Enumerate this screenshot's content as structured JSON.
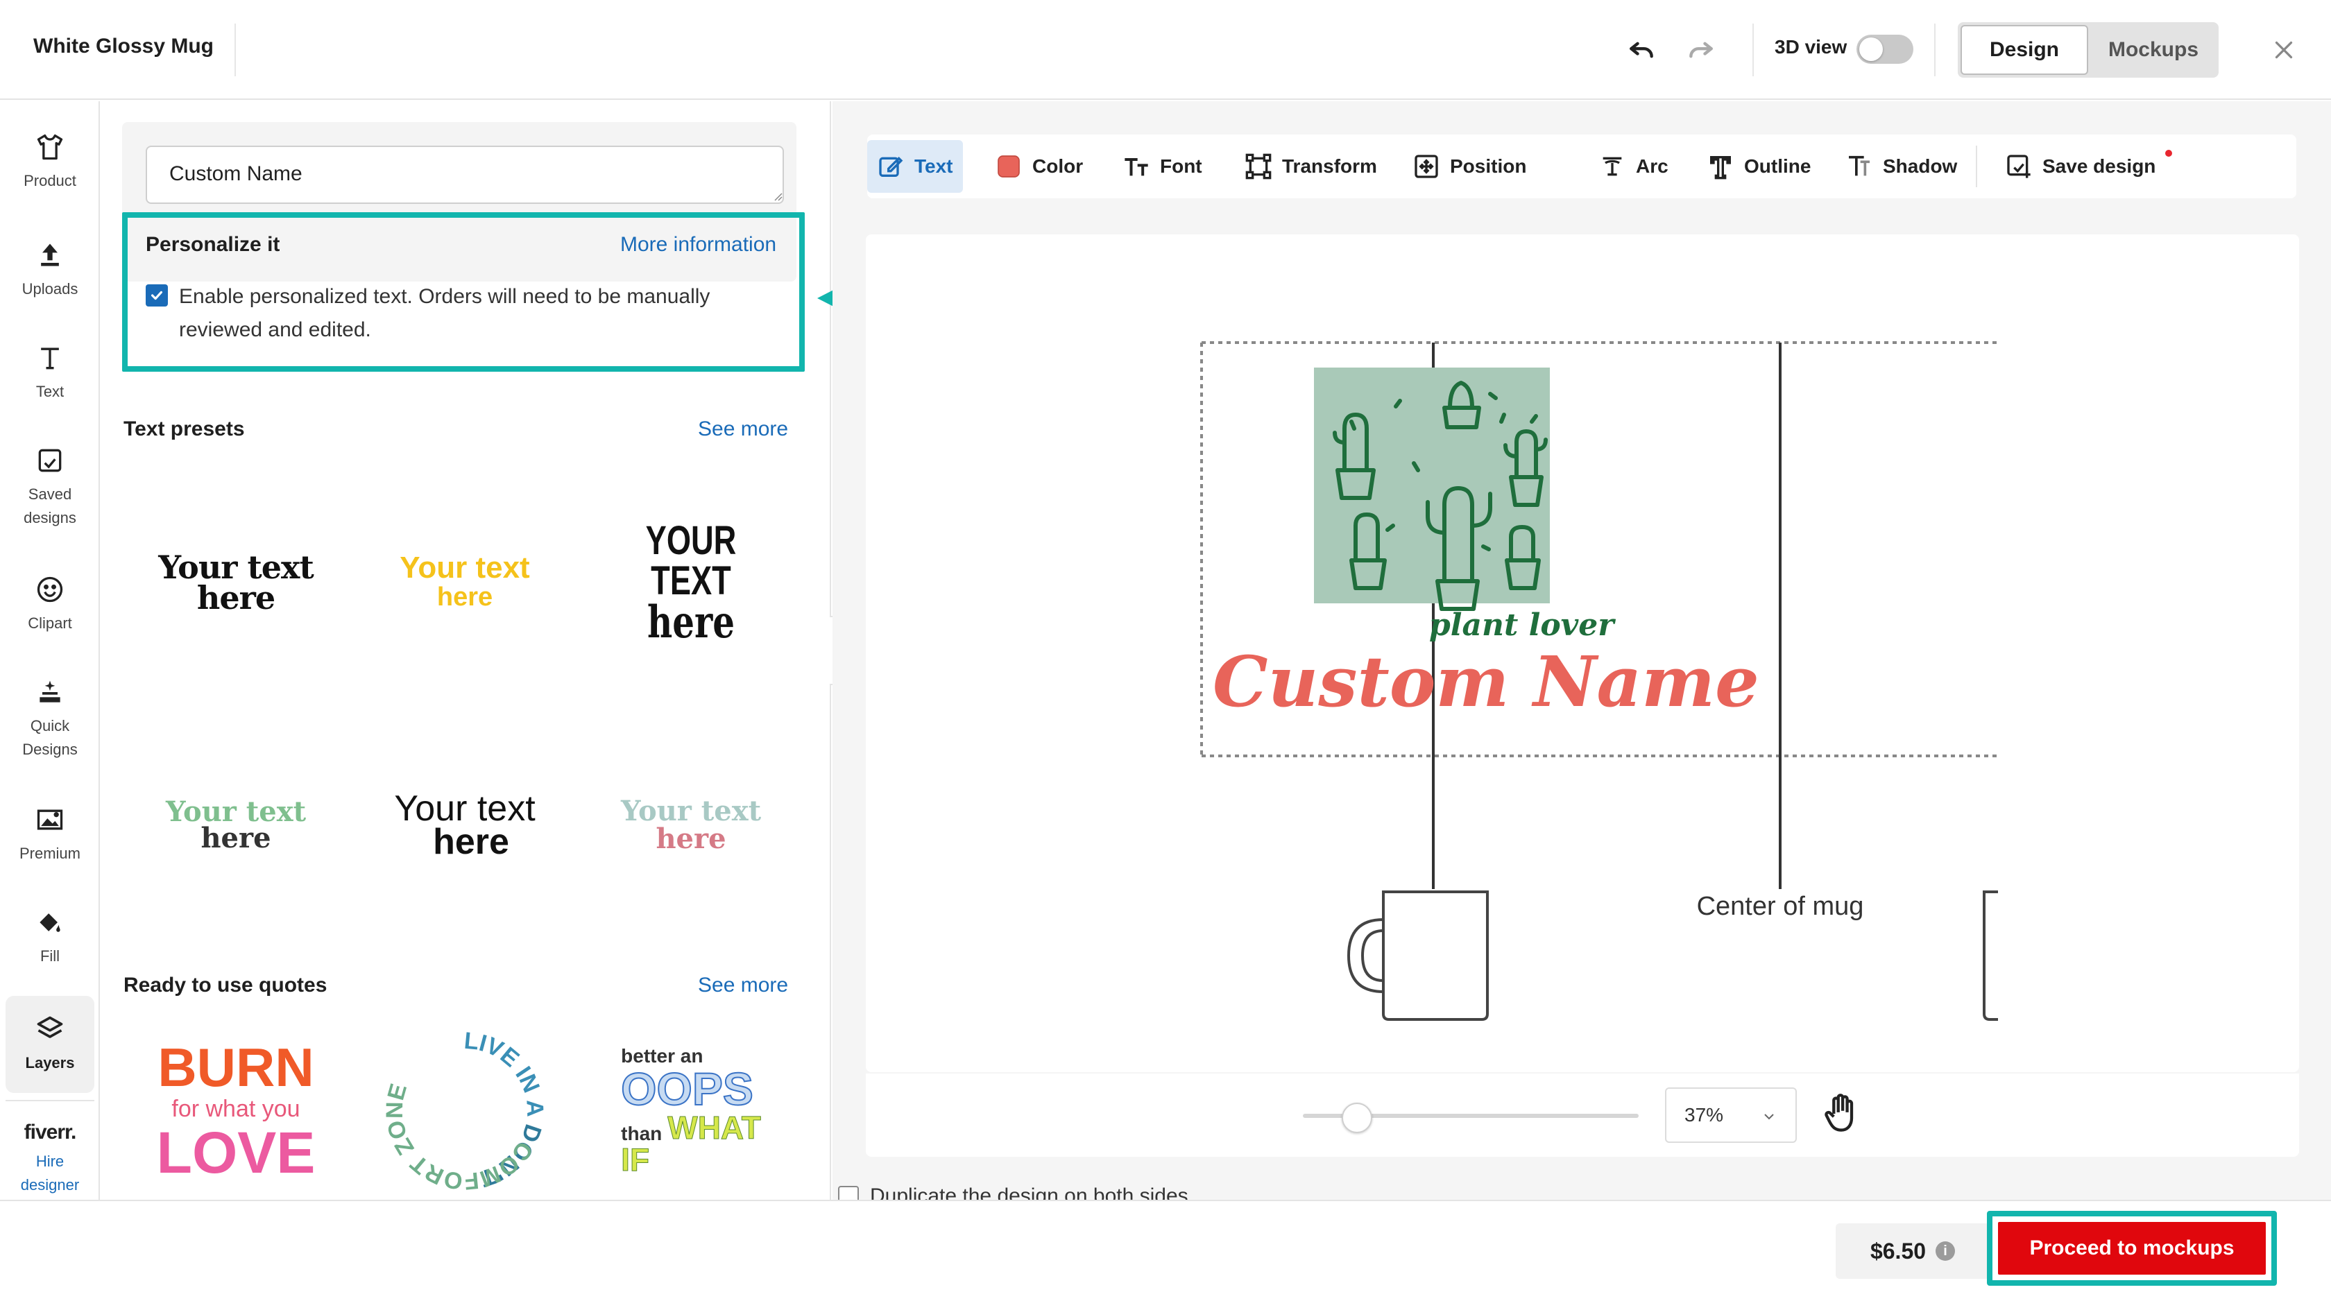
{
  "header": {
    "title": "White Glossy Mug",
    "view3d_label": "3D view",
    "tabs": [
      {
        "label": "Design",
        "active": true
      },
      {
        "label": "Mockups",
        "active": false
      }
    ]
  },
  "rail": {
    "items": [
      {
        "label": "Product"
      },
      {
        "label": "Uploads"
      },
      {
        "label": "Text"
      },
      {
        "label": "Saved designs"
      },
      {
        "label": "Clipart"
      },
      {
        "label": "Quick Designs"
      },
      {
        "label": "Premium"
      },
      {
        "label": "Fill"
      },
      {
        "label": "Layers",
        "active": true
      }
    ],
    "fiverr": "fiverr.",
    "hire": "Hire designer"
  },
  "panel": {
    "text_value": "Custom Name",
    "personalize": {
      "title": "Personalize it",
      "more": "More information",
      "checkbox_text": "Enable personalized text. Orders will need to be manually reviewed and edited.",
      "checked": true
    },
    "presets": {
      "title": "Text presets",
      "see_more": "See more",
      "items": [
        {
          "line1": "Your text",
          "line2": "here"
        },
        {
          "line1": "Your text",
          "line2": "here"
        },
        {
          "line1": "YOUR TEXT",
          "line2": "here"
        },
        {
          "line1": "Your text",
          "line2": "here"
        },
        {
          "line1": "Your text",
          "line2": "here"
        },
        {
          "line1": "Your text",
          "line2": "here"
        }
      ]
    },
    "quotes": {
      "title": "Ready to use quotes",
      "see_more": "See more",
      "q1": {
        "a": "BURN",
        "b": "for what you",
        "c": "LOVE"
      },
      "q2": {
        "a": "LIVE IN A",
        "b": "DON'T",
        "c": "COMFORT ZONE"
      },
      "q3": {
        "a": "better an",
        "b": "OOPS",
        "c": "than",
        "d": "WHAT",
        "e": "IF"
      }
    }
  },
  "toolbar": {
    "tools": [
      {
        "label": "Text",
        "icon": "edit-icon",
        "active": true
      },
      {
        "label": "Color",
        "icon": "color-swatch-icon",
        "color": "#e8645a"
      },
      {
        "label": "Font",
        "icon": "font-icon"
      },
      {
        "label": "Transform",
        "icon": "transform-icon"
      },
      {
        "label": "Position",
        "icon": "position-icon"
      },
      {
        "label": "Arc",
        "icon": "arc-icon"
      },
      {
        "label": "Outline",
        "icon": "outline-icon"
      },
      {
        "label": "Shadow",
        "icon": "shadow-icon"
      },
      {
        "label": "Save design",
        "icon": "save-design-icon",
        "has_dot": true
      }
    ]
  },
  "canvas": {
    "plant_text": "plant lover",
    "name_text": "Custom Name",
    "center_label": "Center of mug"
  },
  "zoom": {
    "value": "37%",
    "slider_value": 0.37
  },
  "duplicate_label": "Duplicate the design on both sides",
  "footer": {
    "price": "$6.50",
    "proceed_label": "Proceed to mockups"
  },
  "colors": {
    "accent": "#12b5ad",
    "link": "#1a6bb8",
    "cta": "#e0070d",
    "design_green": "#1f6e3c",
    "design_coral": "#e8645a",
    "design_bg": "#a9c9b8"
  }
}
